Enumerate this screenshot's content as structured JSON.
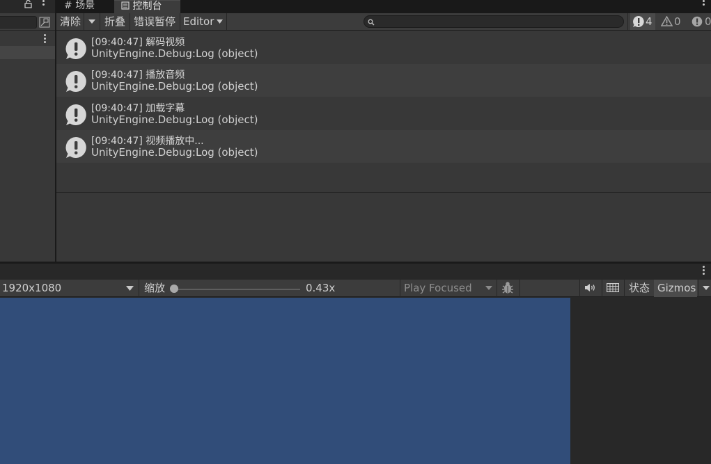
{
  "tabs": {
    "scene": "场景",
    "console": "控制台"
  },
  "console_toolbar": {
    "clear": "清除",
    "collapse": "折叠",
    "error_pause": "错误暂停",
    "editor": "Editor",
    "search": {
      "placeholder": "",
      "value": ""
    },
    "counts": {
      "log": "4",
      "warning": "0",
      "error": "0"
    }
  },
  "log_entries": [
    {
      "time": "[09:40:47]",
      "message": "解码视频",
      "source": "UnityEngine.Debug:Log (object)"
    },
    {
      "time": "[09:40:47]",
      "message": "播放音频",
      "source": "UnityEngine.Debug:Log (object)"
    },
    {
      "time": "[09:40:47]",
      "message": "加载字幕",
      "source": "UnityEngine.Debug:Log (object)"
    },
    {
      "time": "[09:40:47]",
      "message": "视频播放中...",
      "source": "UnityEngine.Debug:Log (object)"
    }
  ],
  "game_toolbar": {
    "resolution": "1920x1080",
    "scale_label": "缩放",
    "scale_value": "0.43x",
    "play_mode": "Play Focused",
    "stats": "状态",
    "gizmos": "Gizmos"
  },
  "colors": {
    "game_background": "#314d79",
    "panel": "#383838",
    "toolbar": "#3c3c3c"
  }
}
